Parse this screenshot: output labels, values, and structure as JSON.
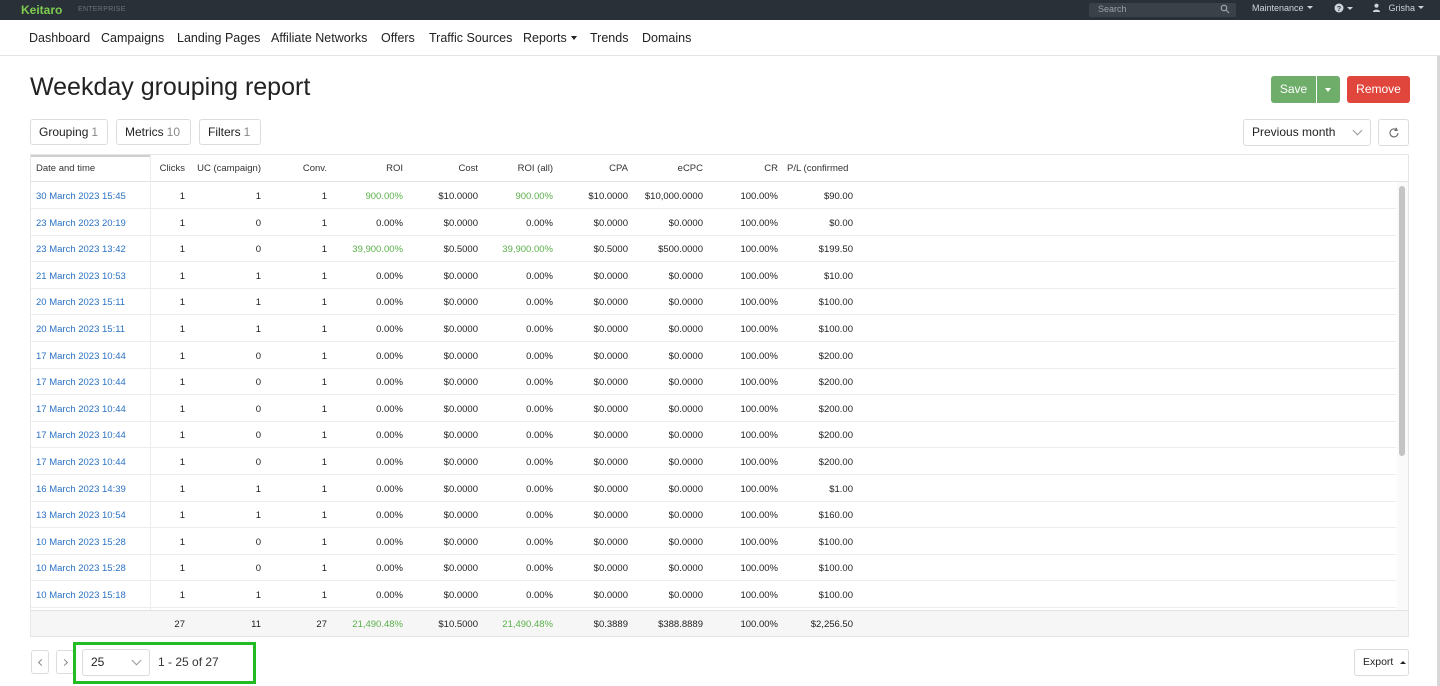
{
  "topbar": {
    "logo": "Keitaro",
    "edition": "ENTERPRISE",
    "search_placeholder": "Search",
    "maintenance": "Maintenance",
    "user": "Grisha"
  },
  "nav": {
    "items": [
      "Dashboard",
      "Campaigns",
      "Landing Pages",
      "Affiliate Networks",
      "Offers",
      "Traffic Sources",
      "Reports",
      "Trends",
      "Domains"
    ]
  },
  "page": {
    "title": "Weekday grouping report",
    "save_label": "Save",
    "remove_label": "Remove"
  },
  "toolbar": {
    "grouping_label": "Grouping",
    "grouping_count": "1",
    "metrics_label": "Metrics",
    "metrics_count": "10",
    "filters_label": "Filters",
    "filters_count": "1",
    "period": "Previous month"
  },
  "table": {
    "headers": [
      "Date and time",
      "Clicks",
      "UC (campaign)",
      "Conv.",
      "ROI",
      "Cost",
      "ROI (all)",
      "CPA",
      "eCPC",
      "CR",
      "P/L (confirmed"
    ],
    "rows": [
      [
        "30 March 2023 15:45",
        "1",
        "1",
        "1",
        "900.00%",
        "$10.0000",
        "900.00%",
        "$10.0000",
        "$10,000.0000",
        "100.00%",
        "$90.00"
      ],
      [
        "23 March 2023 20:19",
        "1",
        "0",
        "1",
        "0.00%",
        "$0.0000",
        "0.00%",
        "$0.0000",
        "$0.0000",
        "100.00%",
        "$0.00"
      ],
      [
        "23 March 2023 13:42",
        "1",
        "0",
        "1",
        "39,900.00%",
        "$0.5000",
        "39,900.00%",
        "$0.5000",
        "$500.0000",
        "100.00%",
        "$199.50"
      ],
      [
        "21 March 2023 10:53",
        "1",
        "1",
        "1",
        "0.00%",
        "$0.0000",
        "0.00%",
        "$0.0000",
        "$0.0000",
        "100.00%",
        "$10.00"
      ],
      [
        "20 March 2023 15:11",
        "1",
        "1",
        "1",
        "0.00%",
        "$0.0000",
        "0.00%",
        "$0.0000",
        "$0.0000",
        "100.00%",
        "$100.00"
      ],
      [
        "20 March 2023 15:11",
        "1",
        "1",
        "1",
        "0.00%",
        "$0.0000",
        "0.00%",
        "$0.0000",
        "$0.0000",
        "100.00%",
        "$100.00"
      ],
      [
        "17 March 2023 10:44",
        "1",
        "0",
        "1",
        "0.00%",
        "$0.0000",
        "0.00%",
        "$0.0000",
        "$0.0000",
        "100.00%",
        "$200.00"
      ],
      [
        "17 March 2023 10:44",
        "1",
        "0",
        "1",
        "0.00%",
        "$0.0000",
        "0.00%",
        "$0.0000",
        "$0.0000",
        "100.00%",
        "$200.00"
      ],
      [
        "17 March 2023 10:44",
        "1",
        "0",
        "1",
        "0.00%",
        "$0.0000",
        "0.00%",
        "$0.0000",
        "$0.0000",
        "100.00%",
        "$200.00"
      ],
      [
        "17 March 2023 10:44",
        "1",
        "0",
        "1",
        "0.00%",
        "$0.0000",
        "0.00%",
        "$0.0000",
        "$0.0000",
        "100.00%",
        "$200.00"
      ],
      [
        "17 March 2023 10:44",
        "1",
        "0",
        "1",
        "0.00%",
        "$0.0000",
        "0.00%",
        "$0.0000",
        "$0.0000",
        "100.00%",
        "$200.00"
      ],
      [
        "16 March 2023 14:39",
        "1",
        "1",
        "1",
        "0.00%",
        "$0.0000",
        "0.00%",
        "$0.0000",
        "$0.0000",
        "100.00%",
        "$1.00"
      ],
      [
        "13 March 2023 10:54",
        "1",
        "1",
        "1",
        "0.00%",
        "$0.0000",
        "0.00%",
        "$0.0000",
        "$0.0000",
        "100.00%",
        "$160.00"
      ],
      [
        "10 March 2023 15:28",
        "1",
        "0",
        "1",
        "0.00%",
        "$0.0000",
        "0.00%",
        "$0.0000",
        "$0.0000",
        "100.00%",
        "$100.00"
      ],
      [
        "10 March 2023 15:28",
        "1",
        "0",
        "1",
        "0.00%",
        "$0.0000",
        "0.00%",
        "$0.0000",
        "$0.0000",
        "100.00%",
        "$100.00"
      ],
      [
        "10 March 2023 15:18",
        "1",
        "1",
        "1",
        "0.00%",
        "$0.0000",
        "0.00%",
        "$0.0000",
        "$0.0000",
        "100.00%",
        "$100.00"
      ]
    ],
    "totals": [
      "",
      "27",
      "11",
      "27",
      "21,490.48%",
      "$10.5000",
      "21,490.48%",
      "$0.3889",
      "$388.8889",
      "100.00%",
      "$2,256.50"
    ]
  },
  "pagination": {
    "per_page": "25",
    "range": "1 - 25 of 27",
    "export_label": "Export"
  },
  "colors": {
    "link": "#2a72c5",
    "positive": "#5ab04a",
    "save": "#6fae6a",
    "remove": "#e0463b",
    "highlight": "#22bb22"
  }
}
